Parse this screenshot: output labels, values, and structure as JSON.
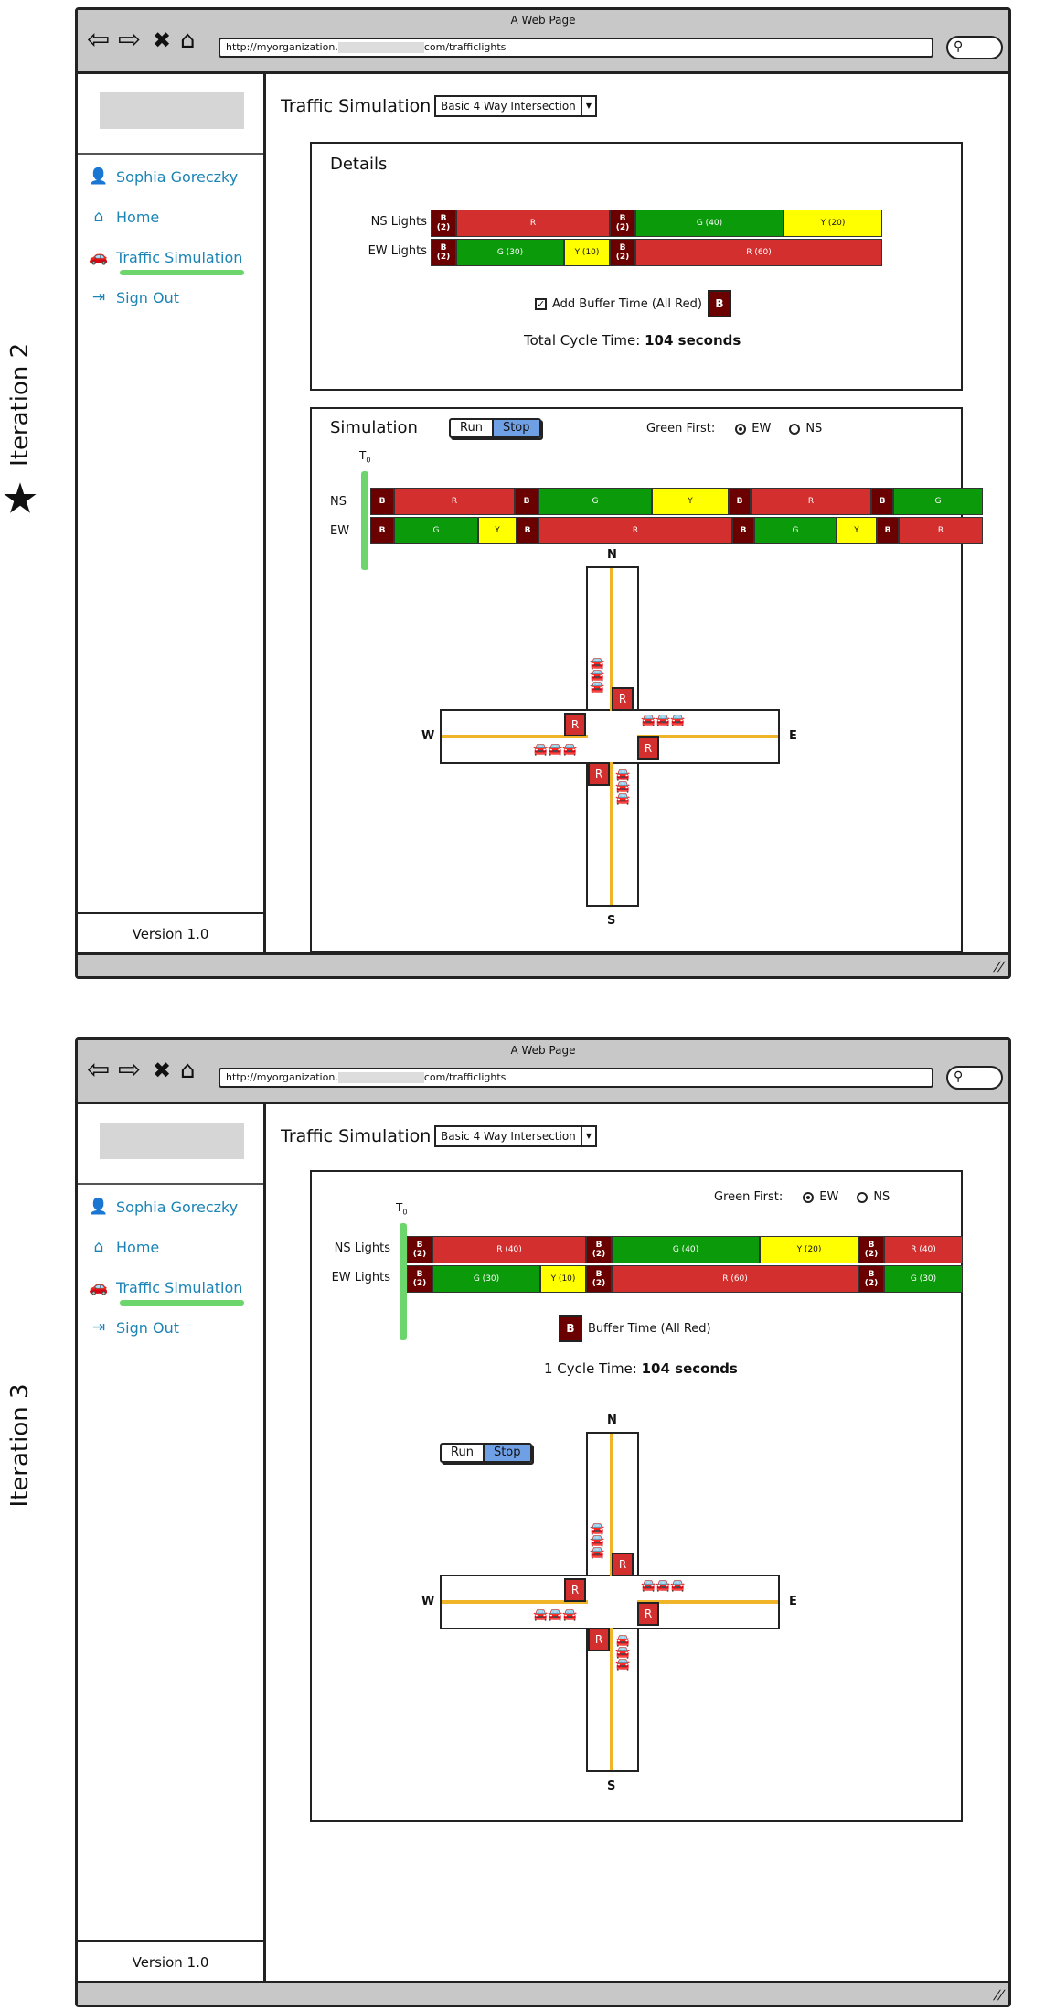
{
  "iterations": [
    {
      "label": "Iteration 2",
      "window_title": "A Web Page",
      "url_prefix": "http://myorganization.",
      "url_suffix": "com/trafficlights",
      "sidebar": {
        "user": "Sophia Goreczky",
        "home": "Home",
        "traffic": "Traffic Simulation",
        "signout": "Sign Out",
        "version": "Version 1.0"
      },
      "page_title": "Traffic Simulation",
      "dropdown": "Basic 4 Way Intersection",
      "details_title": "Details",
      "ns_label": "NS Lights",
      "ew_label": "EW Lights",
      "ns_input": "40",
      "buffer_label": "Add Buffer Time (All Red)",
      "buffer_tag": "B",
      "cycle_prefix": "Total Cycle Time:",
      "cycle_value": "104 seconds",
      "sim_title": "Simulation",
      "run": "Run",
      "stop": "Stop",
      "green_first": "Green First:",
      "opt_ew": "EW",
      "opt_ns": "NS",
      "t0": "T",
      "t0_sub": "0",
      "sim_ns": "NS",
      "sim_ew": "EW",
      "compass": {
        "n": "N",
        "s": "S",
        "e": "E",
        "w": "W"
      },
      "light_r": "R"
    },
    {
      "label": "Iteration 3",
      "window_title": "A Web Page",
      "url_prefix": "http://myorganization.",
      "url_suffix": "com/trafficlights",
      "sidebar": {
        "user": "Sophia Goreczky",
        "home": "Home",
        "traffic": "Traffic Simulation",
        "signout": "Sign Out",
        "version": "Version 1.0"
      },
      "page_title": "Traffic Simulation",
      "dropdown": "Basic 4 Way Intersection",
      "green_first": "Green First:",
      "opt_ew": "EW",
      "opt_ns": "NS",
      "t0": "T",
      "t0_sub": "0",
      "ns_label": "NS Lights",
      "ew_label": "EW Lights",
      "ns_input": "40",
      "buffer_tag": "B",
      "buffer_label": "Buffer Time (All Red)",
      "cycle_prefix": "1 Cycle Time:",
      "cycle_value": "104 seconds",
      "run": "Run",
      "stop": "Stop",
      "compass": {
        "n": "N",
        "s": "S",
        "e": "E",
        "w": "W"
      },
      "light_r": "R"
    }
  ],
  "colors": {
    "buffer": "#6b0000",
    "red": "#d32f2f",
    "green": "#0a9a0a",
    "yellow": "#ffff00",
    "link": "#1b84b5",
    "highlight": "#6cd66c",
    "stop_button": "#6fa0e6"
  },
  "bars": {
    "it2_ns": [
      {
        "t": "b",
        "l": "B\n(2)"
      },
      {
        "t": "r",
        "l": "R"
      },
      {
        "t": "b",
        "l": "B\n(2)"
      },
      {
        "t": "g",
        "l": "G (40)"
      },
      {
        "t": "y",
        "l": "Y (20)"
      }
    ],
    "it2_ew": [
      {
        "t": "b",
        "l": "B\n(2)"
      },
      {
        "t": "g",
        "l": "G (30)"
      },
      {
        "t": "y",
        "l": "Y (10)"
      },
      {
        "t": "b",
        "l": "B\n(2)"
      },
      {
        "t": "r",
        "l": "R (60)"
      }
    ],
    "it2_sim_ns": [
      {
        "t": "b",
        "l": "B"
      },
      {
        "t": "r",
        "l": "R"
      },
      {
        "t": "b",
        "l": "B"
      },
      {
        "t": "g",
        "l": "G"
      },
      {
        "t": "y",
        "l": "Y"
      },
      {
        "t": "b",
        "l": "B"
      },
      {
        "t": "r",
        "l": "R"
      },
      {
        "t": "b",
        "l": "B"
      },
      {
        "t": "g",
        "l": "G"
      }
    ],
    "it2_sim_ew": [
      {
        "t": "b",
        "l": "B"
      },
      {
        "t": "g",
        "l": "G"
      },
      {
        "t": "y",
        "l": "Y"
      },
      {
        "t": "b",
        "l": "B"
      },
      {
        "t": "r",
        "l": "R"
      },
      {
        "t": "b",
        "l": "B"
      },
      {
        "t": "g",
        "l": "G"
      },
      {
        "t": "y",
        "l": "Y"
      },
      {
        "t": "b",
        "l": "B"
      },
      {
        "t": "r",
        "l": "R"
      }
    ],
    "it3_ns": [
      {
        "t": "b",
        "l": "B\n(2)"
      },
      {
        "t": "r",
        "l": "R (40)"
      },
      {
        "t": "b",
        "l": "B\n(2)"
      },
      {
        "t": "g",
        "l": "G (40)"
      },
      {
        "t": "y",
        "l": "Y (20)"
      },
      {
        "t": "b",
        "l": "B\n(2)"
      },
      {
        "t": "r",
        "l": "R (40)"
      }
    ],
    "it3_ew": [
      {
        "t": "b",
        "l": "B\n(2)"
      },
      {
        "t": "g",
        "l": "G (30)"
      },
      {
        "t": "y",
        "l": "Y (10)"
      },
      {
        "t": "b",
        "l": "B\n(2)"
      },
      {
        "t": "r",
        "l": "R (60)"
      },
      {
        "t": "b",
        "l": "B\n(2)"
      },
      {
        "t": "g",
        "l": "G (30)"
      }
    ]
  }
}
